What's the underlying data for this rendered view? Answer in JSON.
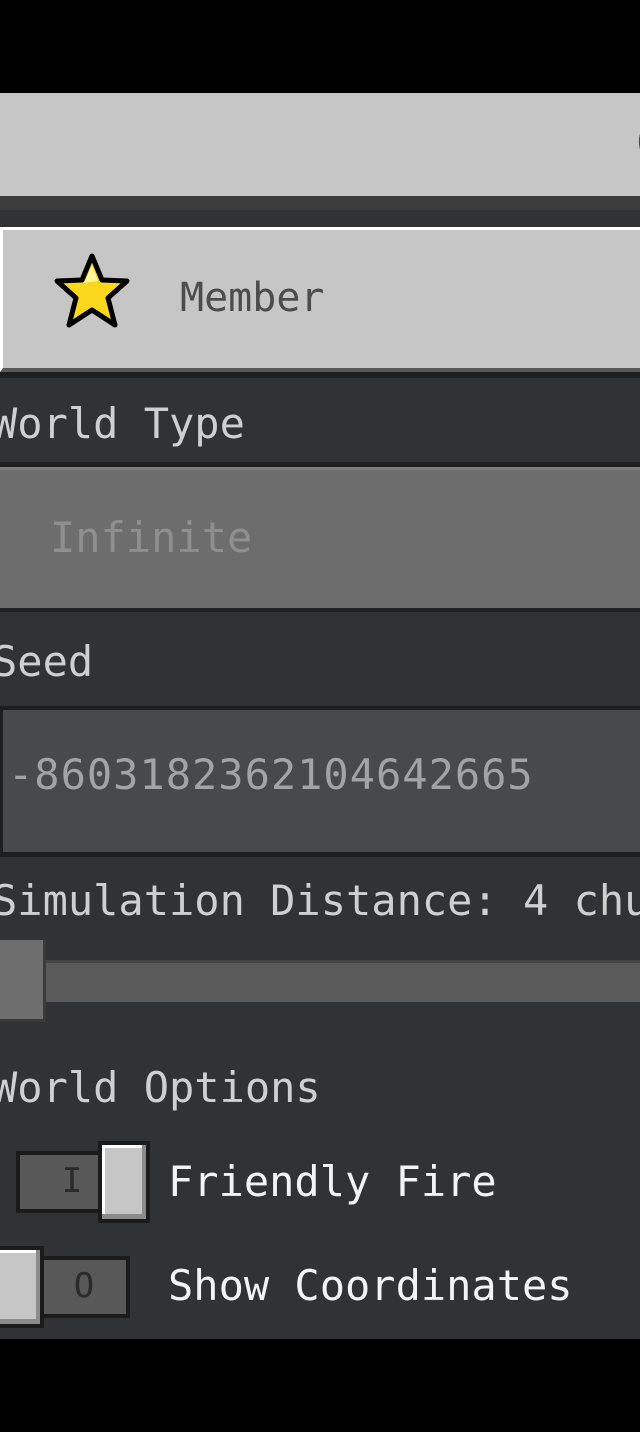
{
  "header": {
    "partial_title": "G"
  },
  "permission": {
    "label": "Member",
    "icon": "star-icon",
    "icon_color": "#f9d71c"
  },
  "world_type": {
    "label": "World Type",
    "value": "Infinite"
  },
  "seed": {
    "label": "Seed",
    "value": "-8603182362104642665"
  },
  "simulation": {
    "label": "Simulation Distance: 4 chu",
    "value_chunks": 4,
    "slider_fraction": 0.0
  },
  "world_options": {
    "heading": "World Options",
    "toggles": [
      {
        "label": "Friendly Fire",
        "state": "on",
        "glyph": "I"
      },
      {
        "label": "Show Coordinates",
        "state": "off",
        "glyph": "O"
      }
    ]
  }
}
